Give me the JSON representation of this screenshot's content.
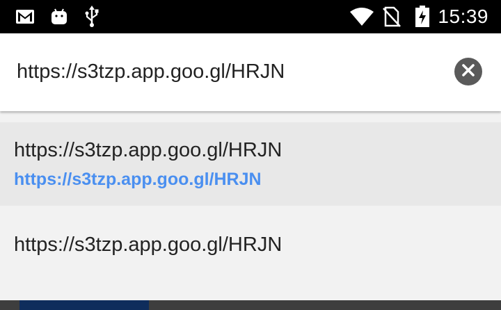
{
  "status_bar": {
    "time": "15:39",
    "icons": [
      "gmail-icon",
      "android-icon",
      "usb-icon",
      "wifi-icon",
      "no-sim-icon",
      "battery-charging-icon"
    ]
  },
  "url_bar": {
    "value": "https://s3tzp.app.goo.gl/HRJN",
    "clear_icon": "close-icon"
  },
  "suggestions": [
    {
      "title": "https://s3tzp.app.goo.gl/HRJN",
      "url": "https://s3tzp.app.goo.gl/HRJN"
    },
    {
      "title": "https://s3tzp.app.goo.gl/HRJN"
    }
  ],
  "colors": {
    "status_bar_bg": "#000000",
    "link_blue": "#4a8ff0",
    "highlight_row": "#e8e8e8",
    "background": "#f2f2f2"
  }
}
